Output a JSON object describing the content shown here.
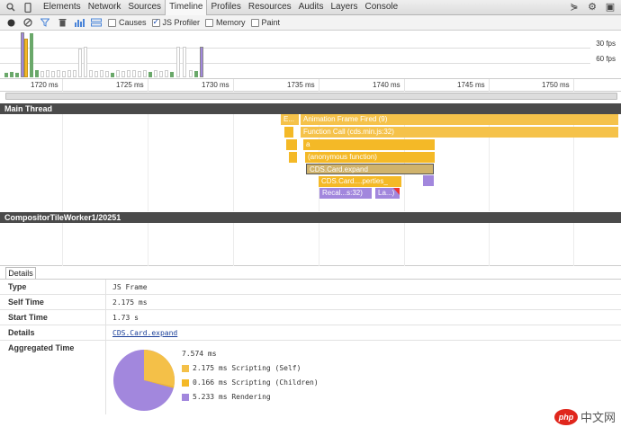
{
  "tabs": [
    "Elements",
    "Network",
    "Sources",
    "Timeline",
    "Profiles",
    "Resources",
    "Audits",
    "Layers",
    "Console"
  ],
  "active_tab": "Timeline",
  "toolbar": {
    "checkboxes": [
      {
        "label": "Causes",
        "checked": false
      },
      {
        "label": "JS Profiler",
        "checked": true
      },
      {
        "label": "Memory",
        "checked": false
      },
      {
        "label": "Paint",
        "checked": false
      }
    ]
  },
  "overview": {
    "fps_30": "30 fps",
    "fps_60": "60 fps"
  },
  "ruler": [
    "1720 ms",
    "1725 ms",
    "1730 ms",
    "1735 ms",
    "1740 ms",
    "1745 ms",
    "1750 ms"
  ],
  "tracks": {
    "main": "Main Thread",
    "compositor": "CompositorTileWorker1/20251"
  },
  "flame": {
    "e": "E...",
    "animation": "Animation Frame Fired (9)",
    "function_call": "Function Call (cds.min.js:32)",
    "a": "a",
    "anon": "(anonymous function)",
    "expand": "CDS.Card.expand",
    "perties": "CDS.Card....perties_",
    "recalc": "Recal...s:32)",
    "la": "La...)"
  },
  "details": {
    "tab_label": "Details",
    "rows": [
      {
        "key": "Type",
        "value": "JS Frame"
      },
      {
        "key": "Self Time",
        "value": "2.175 ms"
      },
      {
        "key": "Start Time",
        "value": "1.73 s"
      },
      {
        "key": "Details",
        "value": "CDS.Card.expand"
      }
    ],
    "aggregated": {
      "label": "Aggregated Time",
      "total": "7.574 ms",
      "items": [
        {
          "label": "2.175 ms Scripting (Self)",
          "color": "#f4c048"
        },
        {
          "label": "0.166 ms Scripting (Children)",
          "color": "#f4b927"
        },
        {
          "label": "5.233 ms Rendering",
          "color": "#a287dd"
        }
      ]
    }
  },
  "colors": {
    "scripting": "#f4b927",
    "rendering": "#a287dd",
    "header": "#4a4a4a"
  },
  "watermark": {
    "logo": "php",
    "text": "中文网"
  }
}
